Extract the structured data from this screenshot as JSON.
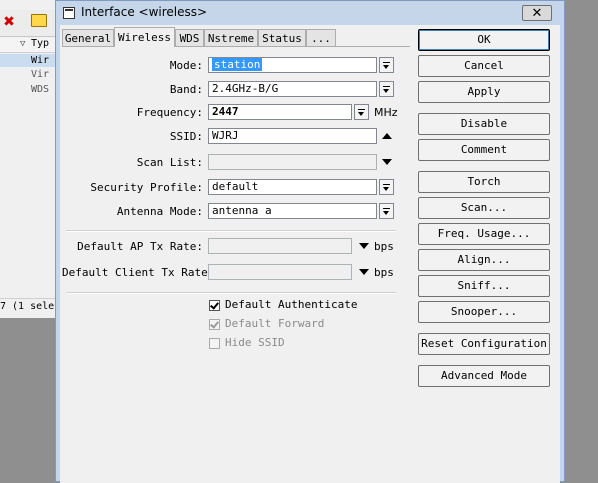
{
  "background_window": {
    "header_label": "Typ",
    "rows": [
      "Wir",
      "Vir",
      "WDS"
    ],
    "status_text": "7 (1 sele"
  },
  "dialog": {
    "title": "Interface <wireless>",
    "close_glyph": "✕"
  },
  "tabs": [
    {
      "label": "General",
      "active": false
    },
    {
      "label": "Wireless",
      "active": true
    },
    {
      "label": "WDS",
      "active": false
    },
    {
      "label": "Nstreme",
      "active": false
    },
    {
      "label": "Status",
      "active": false
    },
    {
      "label": "...",
      "active": false
    }
  ],
  "form": {
    "mode": {
      "label": "Mode:",
      "value": "station"
    },
    "band": {
      "label": "Band:",
      "value": "2.4GHz-B/G"
    },
    "frequency": {
      "label": "Frequency:",
      "value": "2447",
      "unit": "MHz"
    },
    "ssid": {
      "label": "SSID:",
      "value": "WJRJ"
    },
    "scan_list": {
      "label": "Scan List:",
      "value": ""
    },
    "security_profile": {
      "label": "Security Profile:",
      "value": "default"
    },
    "antenna_mode": {
      "label": "Antenna Mode:",
      "value": "antenna a"
    },
    "default_ap_tx_rate": {
      "label": "Default AP Tx Rate:",
      "value": "",
      "unit": "bps"
    },
    "default_client_tx_rate": {
      "label": "Default Client Tx Rate:",
      "value": "",
      "unit": "bps"
    },
    "default_authenticate": {
      "label": "Default Authenticate",
      "checked": true,
      "enabled": true
    },
    "default_forward": {
      "label": "Default Forward",
      "checked": true,
      "enabled": false
    },
    "hide_ssid": {
      "label": "Hide SSID",
      "checked": false,
      "enabled": false
    }
  },
  "buttons": {
    "ok": "OK",
    "cancel": "Cancel",
    "apply": "Apply",
    "disable": "Disable",
    "comment": "Comment",
    "torch": "Torch",
    "scan": "Scan...",
    "freq_usage": "Freq. Usage...",
    "align": "Align...",
    "sniff": "Sniff...",
    "snooper": "Snooper...",
    "reset_configuration": "Reset Configuration",
    "advanced_mode": "Advanced Mode"
  },
  "colors": {
    "titlebar": "#c5d6eb",
    "selection": "#3399ff",
    "close_icon_color": "#d00000"
  }
}
